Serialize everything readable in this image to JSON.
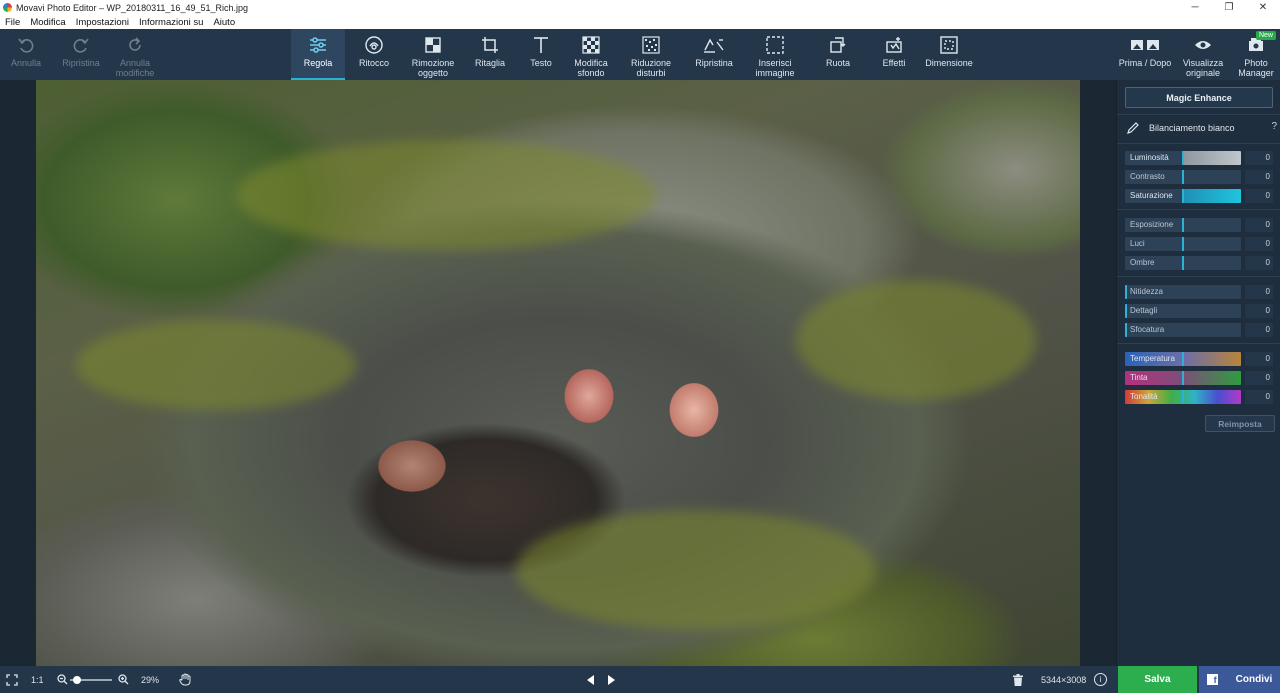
{
  "window": {
    "title": "Movavi Photo Editor – WP_20180311_16_49_51_Rich.jpg",
    "minimize": "─",
    "restore": "❐",
    "close": "✕"
  },
  "menu": [
    "File",
    "Modifica",
    "Impostazioni",
    "Informazioni su",
    "Aiuto"
  ],
  "toolbar": {
    "undo": "Annulla",
    "redo": "Ripristina",
    "undo_all": "Annulla modifiche",
    "tools": [
      {
        "label": "Regola",
        "icon": "sliders-icon",
        "active": true
      },
      {
        "label": "Ritocco",
        "icon": "face-icon"
      },
      {
        "label": "Rimozione oggetto",
        "icon": "eraser-icon"
      },
      {
        "label": "Ritaglia",
        "icon": "crop-icon"
      },
      {
        "label": "Testo",
        "icon": "text-icon"
      },
      {
        "label": "Modifica sfondo",
        "icon": "background-icon"
      },
      {
        "label": "Riduzione disturbi",
        "icon": "noise-icon"
      },
      {
        "label": "Ripristina",
        "icon": "restore-icon"
      },
      {
        "label": "Inserisci immagine",
        "icon": "insert-image-icon"
      },
      {
        "label": "Ruota",
        "icon": "rotate-icon"
      },
      {
        "label": "Effetti",
        "icon": "effects-icon"
      },
      {
        "label": "Dimensione",
        "icon": "resize-icon"
      }
    ],
    "before_after": "Prima / Dopo",
    "view_original": "Visualizza originale",
    "photo_manager": "Photo Manager",
    "new_badge": "New"
  },
  "panel": {
    "magic_enhance": "Magic Enhance",
    "white_balance": "Bilanciamento bianco",
    "help": "?",
    "groups": [
      [
        {
          "label": "Luminosità",
          "value": "0",
          "style": "luminosity",
          "level": 0.5
        },
        {
          "label": "Contrasto",
          "value": "0",
          "style": "plain",
          "level": 0.5
        },
        {
          "label": "Saturazione",
          "value": "0",
          "style": "saturation",
          "level": 0.5
        }
      ],
      [
        {
          "label": "Esposizione",
          "value": "0",
          "style": "plain",
          "level": 0.5
        },
        {
          "label": "Luci",
          "value": "0",
          "style": "plain",
          "level": 0.5
        },
        {
          "label": "Ombre",
          "value": "0",
          "style": "plain",
          "level": 0.5
        }
      ],
      [
        {
          "label": "Nitidezza",
          "value": "0",
          "style": "plain",
          "level": 0
        },
        {
          "label": "Dettagli",
          "value": "0",
          "style": "plain",
          "level": 0
        },
        {
          "label": "Sfocatura",
          "value": "0",
          "style": "plain",
          "level": 0
        }
      ],
      [
        {
          "label": "Temperatura",
          "value": "0",
          "style": "temperature",
          "level": 0.5
        },
        {
          "label": "Tinta",
          "value": "0",
          "style": "tint",
          "level": 0.5
        },
        {
          "label": "Tonalità",
          "value": "0",
          "style": "hue",
          "level": 0.5
        }
      ]
    ],
    "reset": "Reimposta"
  },
  "status": {
    "ratio": "1:1",
    "zoom": "29%",
    "zoom_level": 0.1,
    "dimensions": "5344×3008",
    "info": "i",
    "save": "Salva",
    "share": "Condivi"
  }
}
